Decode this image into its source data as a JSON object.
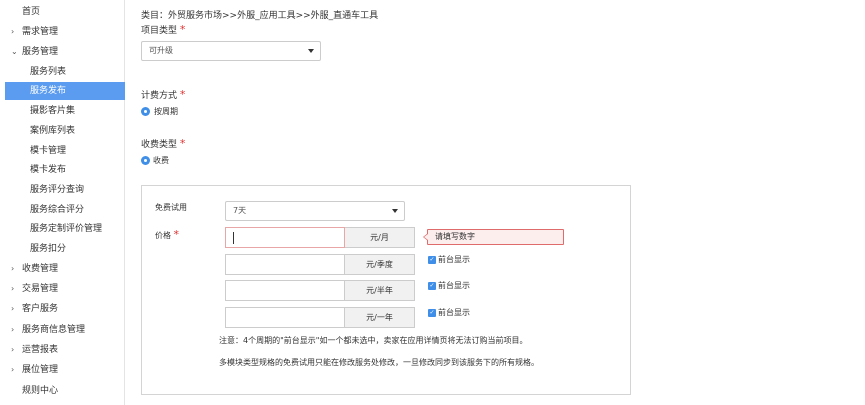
{
  "sidebar": {
    "items": [
      {
        "label": "首页",
        "chevron": "",
        "level": 0,
        "active": false
      },
      {
        "label": "需求管理",
        "chevron": "›",
        "level": 0,
        "active": false
      },
      {
        "label": "服务管理",
        "chevron": "⌄",
        "level": 0,
        "active": false
      },
      {
        "label": "服务列表",
        "chevron": "",
        "level": 1,
        "active": false
      },
      {
        "label": "服务发布",
        "chevron": "",
        "level": 1,
        "active": true
      },
      {
        "label": "摄影客片集",
        "chevron": "",
        "level": 1,
        "active": false
      },
      {
        "label": "案例库列表",
        "chevron": "",
        "level": 1,
        "active": false
      },
      {
        "label": "模卡管理",
        "chevron": "",
        "level": 1,
        "active": false
      },
      {
        "label": "模卡发布",
        "chevron": "",
        "level": 1,
        "active": false
      },
      {
        "label": "服务评分查询",
        "chevron": "",
        "level": 1,
        "active": false
      },
      {
        "label": "服务综合评分",
        "chevron": "",
        "level": 1,
        "active": false
      },
      {
        "label": "服务定制评价管理",
        "chevron": "",
        "level": 1,
        "active": false
      },
      {
        "label": "服务扣分",
        "chevron": "",
        "level": 1,
        "active": false
      },
      {
        "label": "收费管理",
        "chevron": "›",
        "level": 0,
        "active": false
      },
      {
        "label": "交易管理",
        "chevron": "›",
        "level": 0,
        "active": false
      },
      {
        "label": "客户服务",
        "chevron": "›",
        "level": 0,
        "active": false
      },
      {
        "label": "服务商信息管理",
        "chevron": "›",
        "level": 0,
        "active": false
      },
      {
        "label": "运营报表",
        "chevron": "›",
        "level": 0,
        "active": false
      },
      {
        "label": "展位管理",
        "chevron": "›",
        "level": 0,
        "active": false
      },
      {
        "label": "规则中心",
        "chevron": "",
        "level": 0,
        "active": false
      }
    ]
  },
  "form": {
    "category_text": "类目：外贸服务市场>>外服_应用工具>>外服_直通车工具",
    "project_type_label": "项目类型",
    "required_mark": "*",
    "project_type_value": "可升级",
    "billing_label": "计费方式",
    "billing_option": "按周期",
    "charge_label": "收费类型",
    "charge_option": "收费",
    "trial_label": "免费试用",
    "trial_value": "7天",
    "price_label": "价格",
    "price_rows": [
      {
        "unit": "元/月",
        "value": "",
        "error": "请填写数字",
        "show_label": ""
      },
      {
        "unit": "元/季度",
        "value": "",
        "error": "",
        "show_label": "前台显示"
      },
      {
        "unit": "元/半年",
        "value": "",
        "error": "",
        "show_label": "前台显示"
      },
      {
        "unit": "元/一年",
        "value": "",
        "error": "",
        "show_label": "前台显示"
      }
    ],
    "note1": "注意：4个周期的\"前台显示\"如一个都未选中，卖家在应用详情页将无法订购当前项目。",
    "note2": "多模块类型规格的免费试用只能在修改服务处修改，一旦修改同步到该服务下的所有规格。"
  },
  "colors": {
    "accent": "#5b9cf0",
    "required": "#e03232",
    "error_border": "#e06b6b",
    "error_bg": "#fdeeee"
  }
}
